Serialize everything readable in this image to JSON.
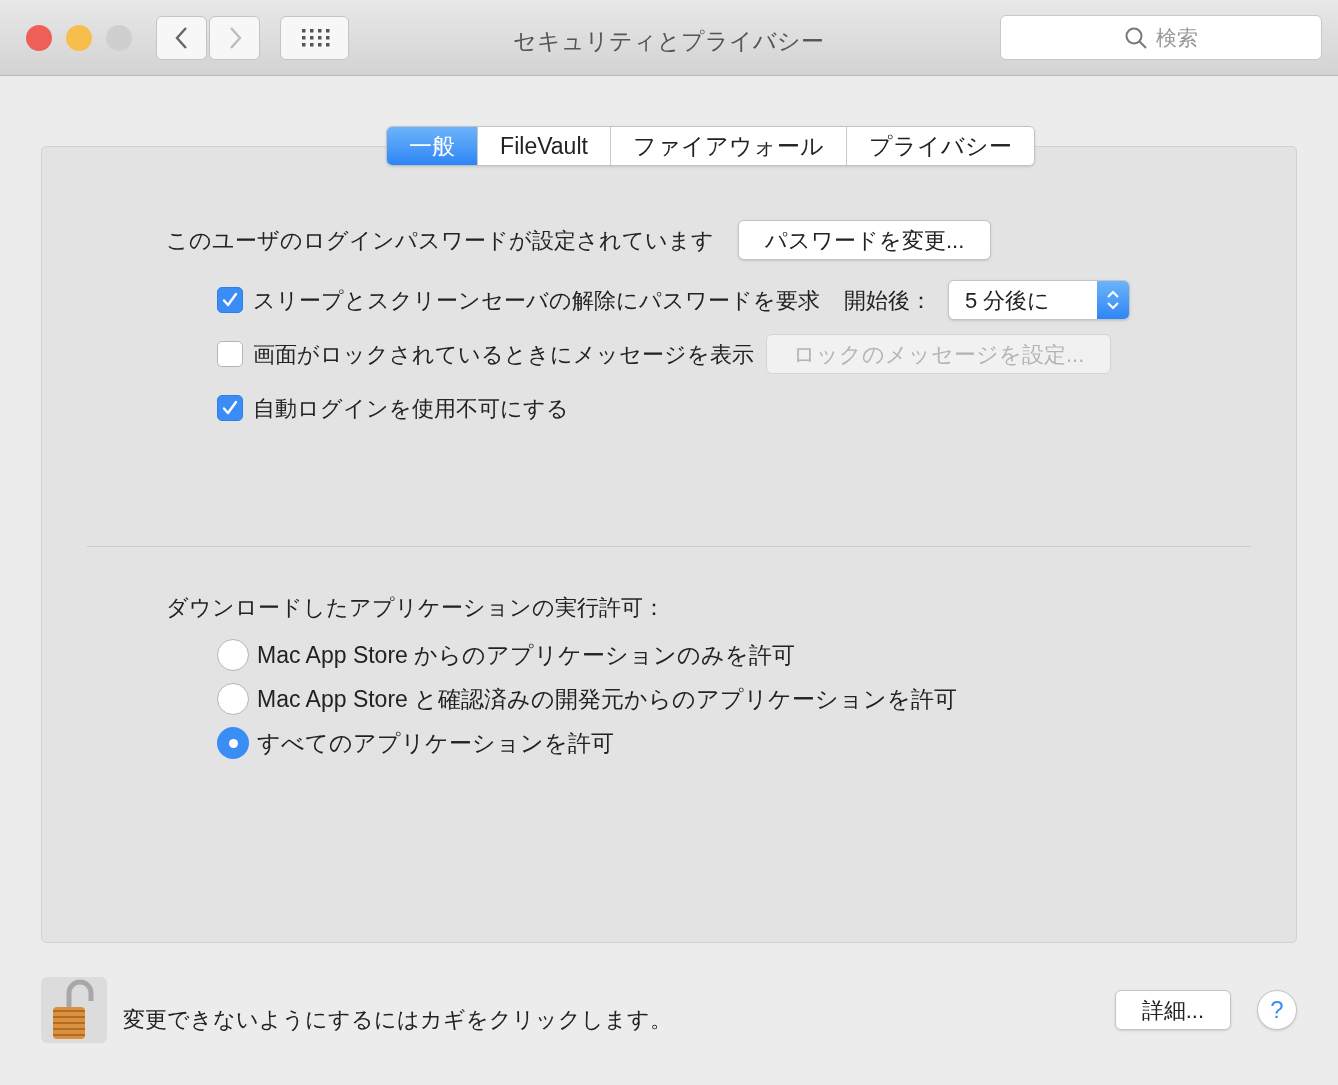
{
  "window": {
    "title": "セキュリティとプライバシー",
    "traffic_lights": [
      {
        "color": "#ee5f57"
      },
      {
        "color": "#f8be4b"
      },
      {
        "color": "#cfcfcf"
      }
    ],
    "nav": [
      {
        "kind": "back",
        "disabled": false
      },
      {
        "kind": "forward",
        "disabled": true
      }
    ],
    "search": {
      "placeholder": "検索"
    }
  },
  "tabs": [
    {
      "label": "一般",
      "selected": true
    },
    {
      "label": "FileVault",
      "selected": false
    },
    {
      "label": "ファイアウォール",
      "selected": false
    },
    {
      "label": "プライバシー",
      "selected": false
    }
  ],
  "password": {
    "label": "このユーザのログインパスワードが設定されています",
    "button": "パスワードを変更..."
  },
  "options": [
    {
      "label": "スリープとスクリーンセーバの解除にパスワードを要求",
      "checked": true,
      "after_label": "開始後：",
      "popup": "5 分後に"
    },
    {
      "label": "画面がロックされているときにメッセージを表示",
      "checked": false,
      "button": {
        "label": "ロックのメッセージを設定...",
        "disabled": true
      }
    },
    {
      "label": "自動ログインを使用不可にする",
      "checked": true
    }
  ],
  "downloads": {
    "label": "ダウンロードしたアプリケーションの実行許可：",
    "choices": [
      {
        "label": "Mac App Store からのアプリケーションのみを許可",
        "selected": false
      },
      {
        "label": "Mac App Store と確認済みの開発元からのアプリケーションを許可",
        "selected": false
      },
      {
        "label": "すべてのアプリケーションを許可",
        "selected": true
      }
    ]
  },
  "footer": {
    "lock_text": "変更できないようにするにはカギをクリックします。",
    "details_button": "詳細...",
    "help": "?"
  }
}
